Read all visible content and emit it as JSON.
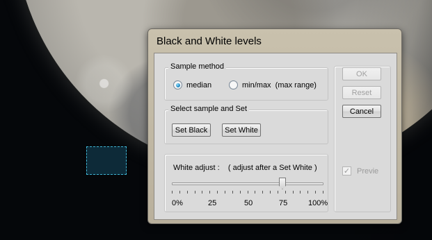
{
  "window": {
    "title": "Black and White levels"
  },
  "sample_method": {
    "group_label": "Sample method",
    "options": [
      {
        "label": "median",
        "selected": true
      },
      {
        "label": "min/max  (max range)",
        "selected": false
      }
    ]
  },
  "select_sample": {
    "group_label": "Select sample and Set",
    "set_black_label": "Set Black",
    "set_white_label": "Set White"
  },
  "white_adjust": {
    "label": "White adjust :    ( adjust after a Set White )",
    "value_percent": 73,
    "scale": [
      "0%",
      "25",
      "50",
      "75",
      "100%"
    ]
  },
  "buttons": {
    "ok_label": "OK",
    "ok_enabled": false,
    "reset_label": "Reset",
    "reset_enabled": false,
    "cancel_label": "Cancel"
  },
  "preview": {
    "label": "Previe",
    "checked": true,
    "enabled": false
  },
  "colors": {
    "selection_outline": "#3fb6d6",
    "radio_selected": "#137bb8"
  }
}
